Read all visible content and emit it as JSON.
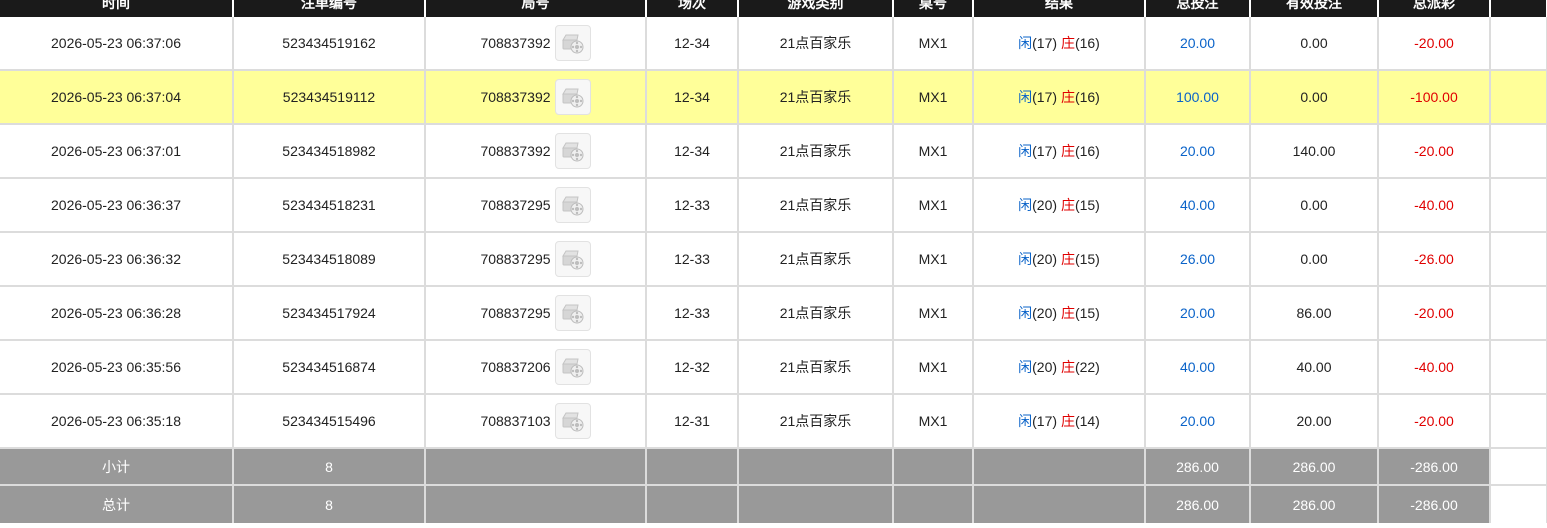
{
  "header": [
    "时间",
    "注单编号",
    "局号",
    "场次",
    "游戏类别",
    "桌号",
    "结果",
    "总投注",
    "有效投注",
    "总派彩",
    ""
  ],
  "rows": [
    {
      "time": "2026-05-23 06:37:06",
      "bet_id": "523434519162",
      "round": "708837392",
      "session": "12-34",
      "game": "21点百家乐",
      "table": "MX1",
      "player_label": "闲",
      "player_score": "(17)",
      "banker_label": "庄",
      "banker_score": "(16)",
      "total_bet": "20.00",
      "valid_bet": "0.00",
      "payout": "-20.00"
    },
    {
      "time": "2026-05-23 06:37:04",
      "bet_id": "523434519112",
      "round": "708837392",
      "session": "12-34",
      "game": "21点百家乐",
      "table": "MX1",
      "player_label": "闲",
      "player_score": "(17)",
      "banker_label": "庄",
      "banker_score": "(16)",
      "total_bet": "100.00",
      "valid_bet": "0.00",
      "payout": "-100.00"
    },
    {
      "time": "2026-05-23 06:37:01",
      "bet_id": "523434518982",
      "round": "708837392",
      "session": "12-34",
      "game": "21点百家乐",
      "table": "MX1",
      "player_label": "闲",
      "player_score": "(17)",
      "banker_label": "庄",
      "banker_score": "(16)",
      "total_bet": "20.00",
      "valid_bet": "140.00",
      "payout": "-20.00"
    },
    {
      "time": "2026-05-23 06:36:37",
      "bet_id": "523434518231",
      "round": "708837295",
      "session": "12-33",
      "game": "21点百家乐",
      "table": "MX1",
      "player_label": "闲",
      "player_score": "(20)",
      "banker_label": "庄",
      "banker_score": "(15)",
      "total_bet": "40.00",
      "valid_bet": "0.00",
      "payout": "-40.00"
    },
    {
      "time": "2026-05-23 06:36:32",
      "bet_id": "523434518089",
      "round": "708837295",
      "session": "12-33",
      "game": "21点百家乐",
      "table": "MX1",
      "player_label": "闲",
      "player_score": "(20)",
      "banker_label": "庄",
      "banker_score": "(15)",
      "total_bet": "26.00",
      "valid_bet": "0.00",
      "payout": "-26.00"
    },
    {
      "time": "2026-05-23 06:36:28",
      "bet_id": "523434517924",
      "round": "708837295",
      "session": "12-33",
      "game": "21点百家乐",
      "table": "MX1",
      "player_label": "闲",
      "player_score": "(20)",
      "banker_label": "庄",
      "banker_score": "(15)",
      "total_bet": "20.00",
      "valid_bet": "86.00",
      "payout": "-20.00"
    },
    {
      "time": "2026-05-23 06:35:56",
      "bet_id": "523434516874",
      "round": "708837206",
      "session": "12-32",
      "game": "21点百家乐",
      "table": "MX1",
      "player_label": "闲",
      "player_score": "(20)",
      "banker_label": "庄",
      "banker_score": "(22)",
      "total_bet": "40.00",
      "valid_bet": "40.00",
      "payout": "-40.00"
    },
    {
      "time": "2026-05-23 06:35:18",
      "bet_id": "523434515496",
      "round": "708837103",
      "session": "12-31",
      "game": "21点百家乐",
      "table": "MX1",
      "player_label": "闲",
      "player_score": "(17)",
      "banker_label": "庄",
      "banker_score": "(14)",
      "total_bet": "20.00",
      "valid_bet": "20.00",
      "payout": "-20.00"
    }
  ],
  "highlighted_row": 1,
  "replay_icon": "video-replay-icon",
  "subtotal": {
    "label": "小计",
    "count": "8",
    "total_bet": "286.00",
    "valid_bet": "286.00",
    "payout": "-286.00"
  },
  "grand_total": {
    "label": "总计",
    "count": "8",
    "total_bet": "286.00",
    "valid_bet": "286.00",
    "payout": "-286.00"
  },
  "colors": {
    "header_bg": "#1a1a1a",
    "highlight": "#ffff99",
    "summary_bg": "#999999",
    "bet_blue": "#0a63c9",
    "payout_red": "#e00000"
  }
}
